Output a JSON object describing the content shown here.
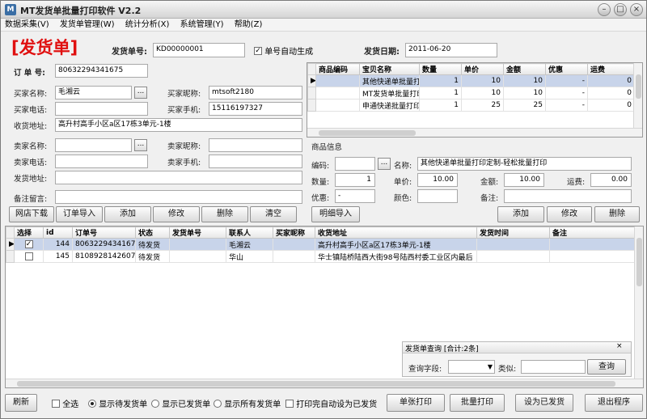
{
  "window": {
    "title": "MT发货单批量打印软件 V2.2",
    "min": "–",
    "max": "□",
    "close": "×"
  },
  "menu": [
    "数据采集(V)",
    "发货单管理(W)",
    "统计分析(X)",
    "系统管理(Y)",
    "帮助(Z)"
  ],
  "header": {
    "heading": "[发货单]",
    "no_label": "发货单号:",
    "no_value": "KD00000001",
    "auto_label": "单号自动生成",
    "auto_checked": true,
    "date_label": "发货日期:",
    "date_value": "2011-06-20"
  },
  "form": {
    "order_no_label": "订 单 号:",
    "order_no": "80632294341675",
    "buyer_name_label": "买家名称:",
    "buyer_name": "毛湘云",
    "buyer_nick_label": "买家昵称:",
    "buyer_nick": "mtsoft2180",
    "buyer_phone_label": "买家电话:",
    "buyer_phone": "",
    "buyer_mobile_label": "买家手机:",
    "buyer_mobile": "15116197327",
    "ship_addr_label": "收货地址:",
    "ship_addr": "高升村高手小区a区17栋3单元-1楼",
    "seller_name_label": "卖家名称:",
    "seller_name": "",
    "seller_nick_label": "卖家昵称:",
    "seller_nick": "",
    "seller_phone_label": "卖家电话:",
    "seller_phone": "",
    "seller_mobile_label": "卖家手机:",
    "seller_mobile": "",
    "send_addr_label": "发货地址:",
    "send_addr": "",
    "remark_label": "备注留言:",
    "remark": "",
    "dots": "..."
  },
  "goods_grid": {
    "columns": [
      "商品编码",
      "宝贝名称",
      "数量",
      "单价",
      "金额",
      "优惠",
      "运费"
    ],
    "rows": [
      {
        "code": "",
        "name": "其他快递单批量打",
        "qty": "1",
        "price": "10",
        "amount": "10",
        "discount": "-",
        "freight": "0"
      },
      {
        "code": "",
        "name": "MT发货单批量打印",
        "qty": "1",
        "price": "10",
        "amount": "10",
        "discount": "-",
        "freight": "0"
      },
      {
        "code": "",
        "name": "申通快递批量打印",
        "qty": "1",
        "price": "25",
        "amount": "25",
        "discount": "-",
        "freight": "0"
      }
    ]
  },
  "goods_info": {
    "title": "商品信息",
    "code_label": "编码:",
    "code": "",
    "name_label": "名称:",
    "name": "其他快递单批量打印定制-轻松批量打印",
    "qty_label": "数量:",
    "qty": "1",
    "price_label": "单价:",
    "price": "10.00",
    "amount_label": "金额:",
    "amount": "10.00",
    "freight_label": "运费:",
    "freight": "0.00",
    "discount_label": "优惠:",
    "discount": "-",
    "color_label": "颜色:",
    "color": "",
    "note_label": "备注:",
    "note": ""
  },
  "left_buttons": [
    "网店下载",
    "订单导入",
    "添加",
    "修改",
    "删除",
    "清空",
    "明细导入"
  ],
  "right_buttons": [
    "添加",
    "修改",
    "删除"
  ],
  "orders_grid": {
    "columns": [
      "选择",
      "id",
      "订单号",
      "状态",
      "发货单号",
      "联系人",
      "买家昵称",
      "收货地址",
      "发货时间",
      "备注"
    ],
    "rows": [
      {
        "checked": true,
        "id": "144",
        "order": "80632294341675",
        "status": "待发货",
        "ship_no": "",
        "contact": "毛湘云",
        "nick": "",
        "addr": "高升村高手小区a区17栋3单元-1楼",
        "time": "",
        "note": ""
      },
      {
        "checked": false,
        "id": "145",
        "order": "81089281426075",
        "status": "待发货",
        "ship_no": "",
        "contact": "华山",
        "nick": "",
        "addr": "华士镇陆桥陆西大街98号陆西村委工业区内最后",
        "time": "",
        "note": ""
      }
    ]
  },
  "query_panel": {
    "title": "发货单查询 [合计:2条]",
    "field_label": "查询字段:",
    "field_value": "",
    "type_label": "类似:",
    "type_value": "",
    "search": "查询"
  },
  "bottom": {
    "refresh": "刷新",
    "select_all": "全选",
    "show_pending": "显示待发货单",
    "show_shipped": "显示已发货单",
    "show_all": "显示所有发货单",
    "auto_mark": "打印完自动设为已发货",
    "selected_filter": "show_pending",
    "print_single": "单张打印",
    "print_batch": "批量打印",
    "set_shipped": "设为已发货",
    "exit": "退出程序"
  }
}
